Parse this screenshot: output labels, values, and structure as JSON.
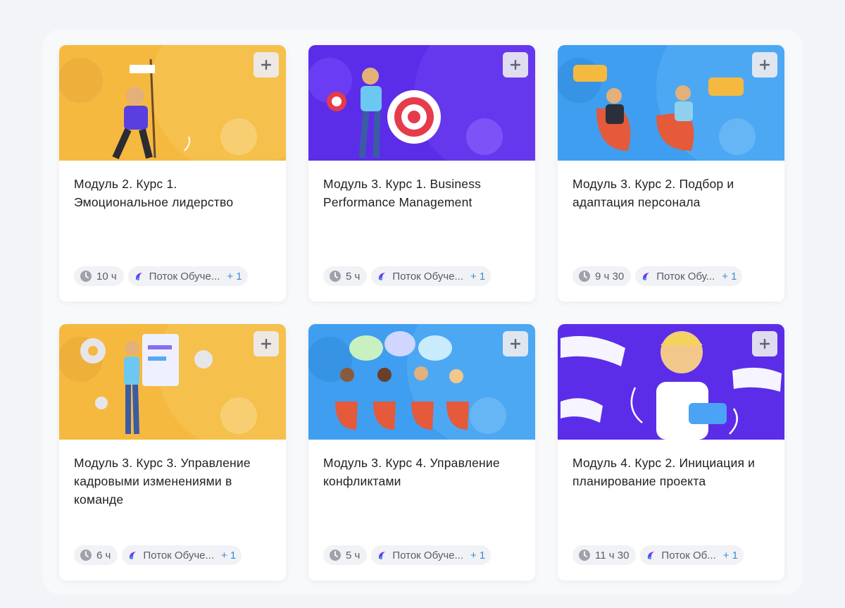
{
  "colors": {
    "yellow": "#f5b940",
    "purple": "#5b2de8",
    "blue": "#3f9ef0",
    "accent_link": "#3d8ad8"
  },
  "icons": {
    "add": "plus-icon",
    "duration": "clock-icon",
    "stream": "stream-logo-icon"
  },
  "courses": [
    {
      "title": "Модуль 2. Курс 1. Эмоциональное лидерство",
      "duration": "10 ч",
      "stream": "Поток Обуче...",
      "extra": "+ 1",
      "theme": "yellow"
    },
    {
      "title": "Модуль 3. Курс 1. Business Performance Management",
      "duration": "5 ч",
      "stream": "Поток Обуче...",
      "extra": "+ 1",
      "theme": "purple"
    },
    {
      "title": "Модуль 3. Курс 2. Подбор и адаптация персонала",
      "duration": "9 ч 30",
      "stream": "Поток Обу...",
      "extra": "+ 1",
      "theme": "blue"
    },
    {
      "title": "Модуль 3. Курс 3. Управление кадровыми изменениями в команде",
      "duration": "6 ч",
      "stream": "Поток Обуче...",
      "extra": "+ 1",
      "theme": "yellow"
    },
    {
      "title": "Модуль 3. Курс 4. Управление конфликтами",
      "duration": "5 ч",
      "stream": "Поток Обуче...",
      "extra": "+ 1",
      "theme": "blue"
    },
    {
      "title": "Модуль 4. Курс 2. Инициация и планирование проекта",
      "duration": "11 ч 30",
      "stream": "Поток Об...",
      "extra": "+ 1",
      "theme": "purple"
    }
  ]
}
